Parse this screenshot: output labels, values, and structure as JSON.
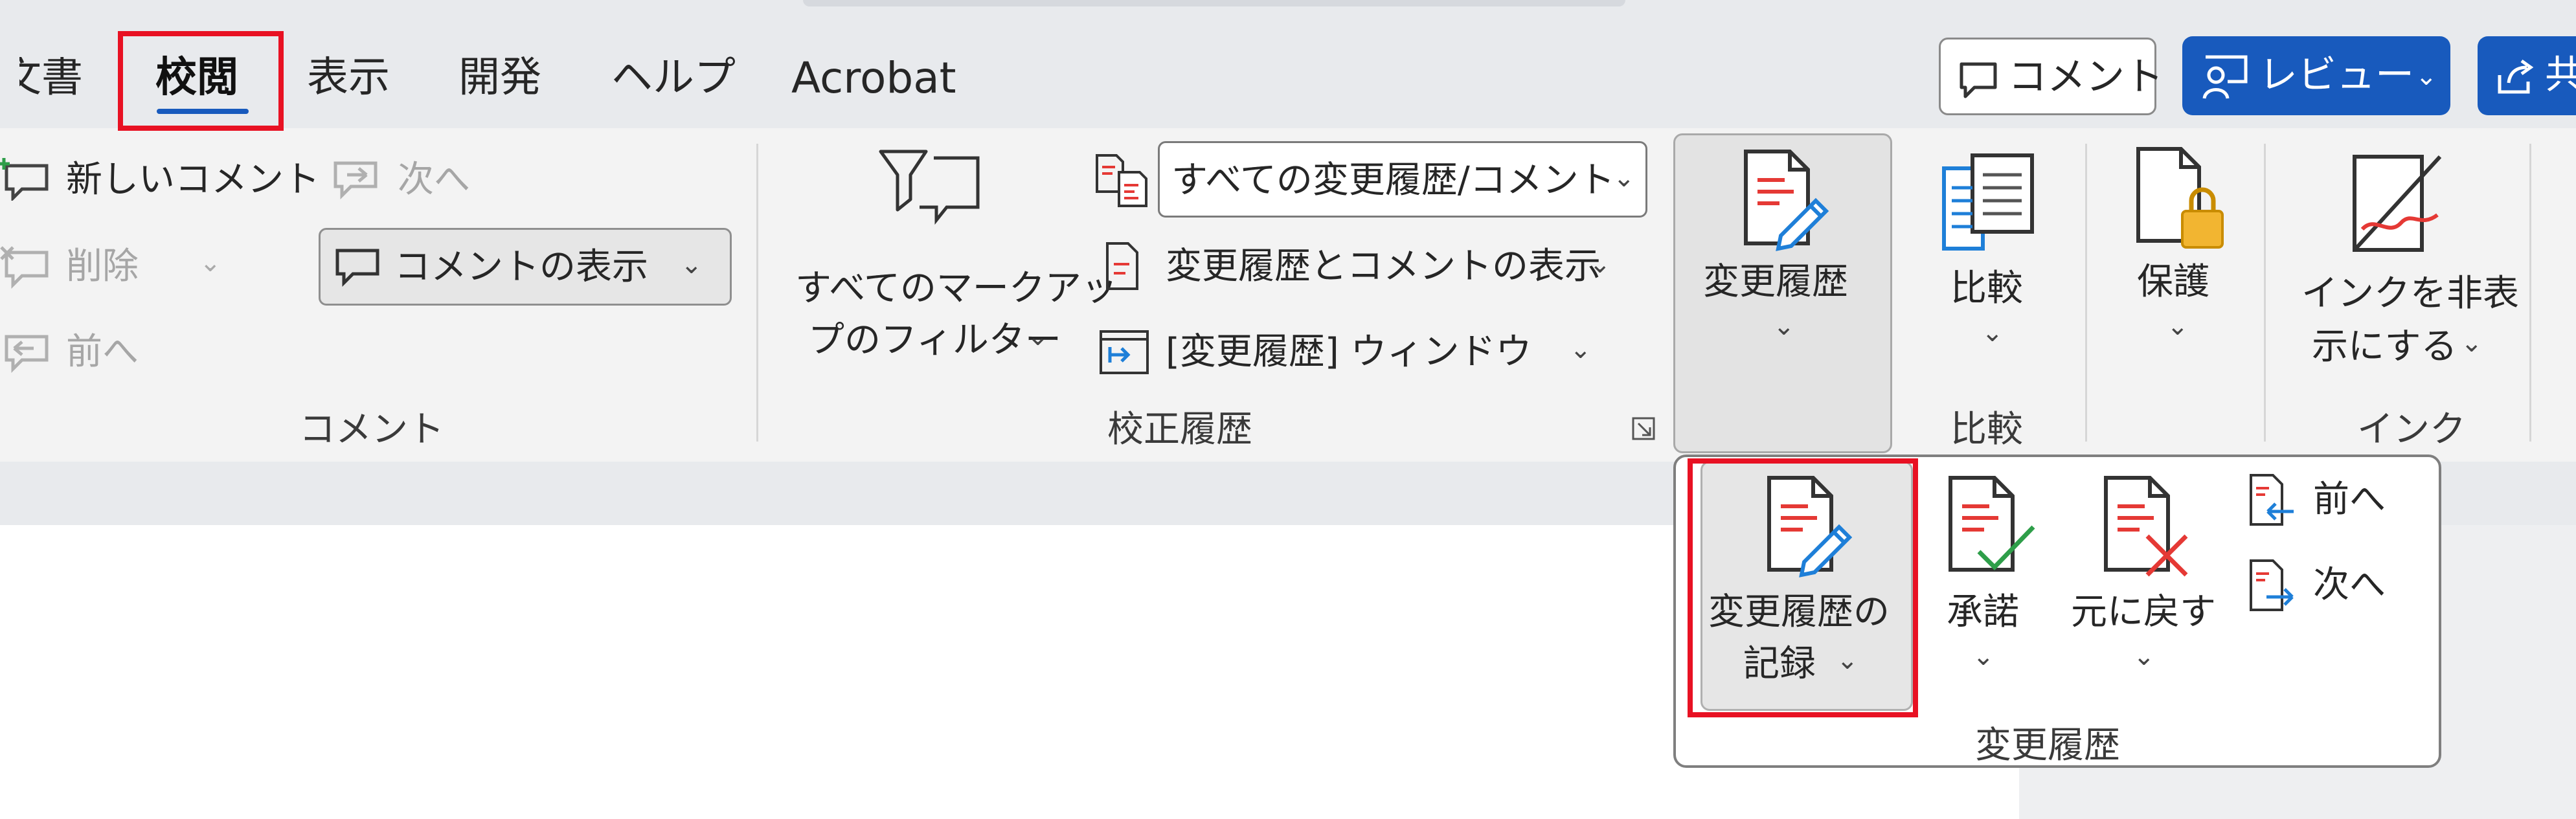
{
  "tabs": [
    {
      "label": "文書",
      "name": "tab-document-partial",
      "active": false
    },
    {
      "label": "校閲",
      "name": "tab-review",
      "active": true
    },
    {
      "label": "表示",
      "name": "tab-view",
      "active": false
    },
    {
      "label": "開発",
      "name": "tab-developer",
      "active": false
    },
    {
      "label": "ヘルプ",
      "name": "tab-help",
      "active": false
    },
    {
      "label": "Acrobat",
      "name": "tab-acrobat",
      "active": false
    }
  ],
  "header": {
    "comment_button": "コメント",
    "review_button": "レビュー",
    "share_partial": "共"
  },
  "comments_group": {
    "new_comment": "新しいコメント",
    "delete": "削除",
    "previous": "前へ",
    "next": "次へ",
    "show_comments": "コメントの表示",
    "label": "コメント"
  },
  "tracking_group": {
    "markup_filter_line1": "すべてのマークアッ",
    "markup_filter_line2": "プのフィルター",
    "display_select": "すべての変更履歴/コメント",
    "show_markup": "変更履歴とコメントの表示",
    "reviewing_pane": "[変更履歴] ウィンドウ",
    "label": "校正履歴"
  },
  "tracked_changes_button": "変更履歴",
  "compare_group": {
    "button": "比較",
    "label": "比較"
  },
  "protect_button": "保護",
  "ink_group": {
    "button_line1": "インクを非表",
    "button_line2": "示にする",
    "label": "インク"
  },
  "popup": {
    "record_line1": "変更履歴の",
    "record_line2": "記録",
    "accept": "承諾",
    "reject": "元に戻す",
    "previous": "前へ",
    "next": "次へ",
    "label": "変更履歴"
  },
  "colors": {
    "accent": "#185abd",
    "highlight": "#e81123",
    "doc_red": "#e53935",
    "accept_green": "#2e9e49"
  }
}
